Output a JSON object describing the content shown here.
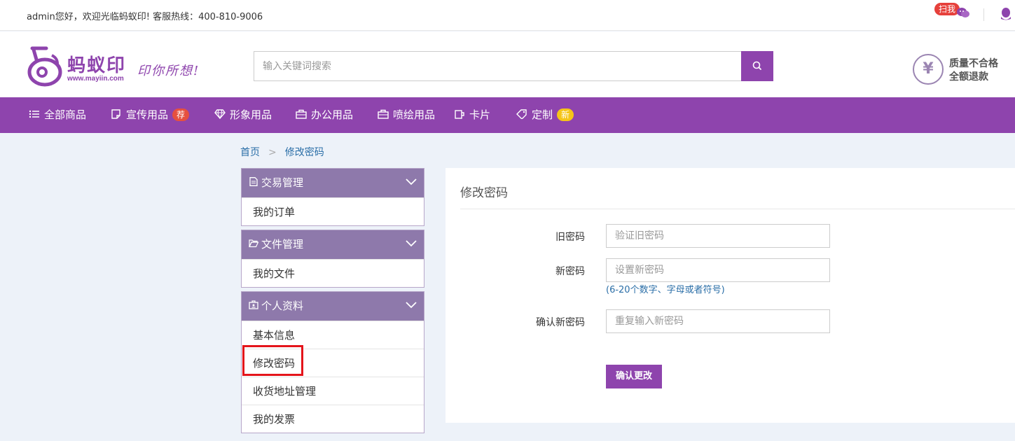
{
  "topbar": {
    "welcome": "admin您好，欢迎光临蚂蚁印! 客服热线：400-810-9006",
    "scan_badge": "扫我"
  },
  "header": {
    "logo_name": "蚂蚁印",
    "logo_url": "www.mayiin.com",
    "slogan": "印你所想!",
    "search_placeholder": "输入关键词搜索",
    "guarantee_symbol": "¥",
    "guarantee_line1": "质量不合格",
    "guarantee_line2": "全额退款"
  },
  "nav": {
    "items": [
      {
        "label": "全部商品",
        "icon": "list-icon"
      },
      {
        "label": "宣传用品",
        "icon": "note-icon",
        "badge": "荐"
      },
      {
        "label": "形象用品",
        "icon": "diamond-icon"
      },
      {
        "label": "办公用品",
        "icon": "briefcase-icon"
      },
      {
        "label": "喷绘用品",
        "icon": "briefcase-icon"
      },
      {
        "label": "卡片",
        "icon": "cup-icon"
      },
      {
        "label": "定制",
        "icon": "tag-icon",
        "badge": "新"
      }
    ],
    "badge_colors": {
      "red": "#e6503f",
      "yellow": "#f5c518"
    }
  },
  "breadcrumb": {
    "home": "首页",
    "separator": ">",
    "current": "修改密码"
  },
  "sidebar": {
    "groups": [
      {
        "title": "交易管理",
        "icon": "file-icon",
        "links": [
          "我的订单"
        ]
      },
      {
        "title": "文件管理",
        "icon": "folder-icon",
        "links": [
          "我的文件"
        ]
      },
      {
        "title": "个人资料",
        "icon": "id-card-icon",
        "links": [
          "基本信息",
          "修改密码",
          "收货地址管理",
          "我的发票"
        ]
      }
    ]
  },
  "form": {
    "title": "修改密码",
    "old_label": "旧密码",
    "old_placeholder": "验证旧密码",
    "new_label": "新密码",
    "new_placeholder": "设置新密码",
    "new_hint": "(6-20个数字、字母或者符号)",
    "confirm_label": "确认新密码",
    "confirm_placeholder": "重复输入新密码",
    "submit_label": "确认更改"
  },
  "colors": {
    "brand": "#8e44ad",
    "sidebar_head": "#8e79ab",
    "link": "#2a6ea7",
    "highlight": "#e4141b",
    "background": "#edf2f9"
  }
}
